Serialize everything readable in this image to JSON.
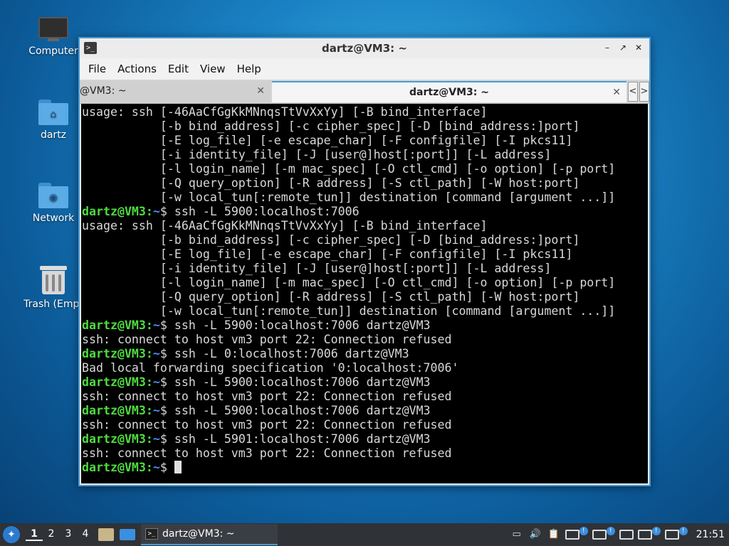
{
  "desktop": {
    "icons": [
      {
        "label": "Computer"
      },
      {
        "label": "dartz"
      },
      {
        "label": "Network"
      },
      {
        "label": "Trash (Empt"
      }
    ]
  },
  "window": {
    "title": "dartz@VM3: ~",
    "controls": {
      "minimize": "–",
      "maximize": "↗",
      "close": "✕"
    }
  },
  "menu": [
    "File",
    "Actions",
    "Edit",
    "View",
    "Help"
  ],
  "tabs": {
    "inactive_label": "@VM3: ~",
    "active_label": "dartz@VM3: ~",
    "close": "✕",
    "prev": "<",
    "next": ">"
  },
  "terminal": {
    "lines": [
      {
        "t": "usage: ssh [-46AaCfGgKkMNnqsTtVvXxYy] [-B bind_interface]"
      },
      {
        "t": "           [-b bind_address] [-c cipher_spec] [-D [bind_address:]port]"
      },
      {
        "t": "           [-E log_file] [-e escape_char] [-F configfile] [-I pkcs11]"
      },
      {
        "t": "           [-i identity_file] [-J [user@]host[:port]] [-L address]"
      },
      {
        "t": "           [-l login_name] [-m mac_spec] [-O ctl_cmd] [-o option] [-p port]"
      },
      {
        "t": "           [-Q query_option] [-R address] [-S ctl_path] [-W host:port]"
      },
      {
        "t": "           [-w local_tun[:remote_tun]] destination [command [argument ...]]"
      },
      {
        "p": "dartz@VM3",
        "path": "~",
        "cmd": "$ ssh -L 5900:localhost:7006"
      },
      {
        "t": "usage: ssh [-46AaCfGgKkMNnqsTtVvXxYy] [-B bind_interface]"
      },
      {
        "t": "           [-b bind_address] [-c cipher_spec] [-D [bind_address:]port]"
      },
      {
        "t": "           [-E log_file] [-e escape_char] [-F configfile] [-I pkcs11]"
      },
      {
        "t": "           [-i identity_file] [-J [user@]host[:port]] [-L address]"
      },
      {
        "t": "           [-l login_name] [-m mac_spec] [-O ctl_cmd] [-o option] [-p port]"
      },
      {
        "t": "           [-Q query_option] [-R address] [-S ctl_path] [-W host:port]"
      },
      {
        "t": "           [-w local_tun[:remote_tun]] destination [command [argument ...]]"
      },
      {
        "p": "dartz@VM3",
        "path": "~",
        "cmd": "$ ssh -L 5900:localhost:7006 dartz@VM3"
      },
      {
        "t": "ssh: connect to host vm3 port 22: Connection refused"
      },
      {
        "p": "dartz@VM3",
        "path": "~",
        "cmd": "$ ssh -L 0:localhost:7006 dartz@VM3"
      },
      {
        "t": "Bad local forwarding specification '0:localhost:7006'"
      },
      {
        "p": "dartz@VM3",
        "path": "~",
        "cmd": "$ ssh -L 5900:localhost:7006 dartz@VM3"
      },
      {
        "t": "ssh: connect to host vm3 port 22: Connection refused"
      },
      {
        "p": "dartz@VM3",
        "path": "~",
        "cmd": "$ ssh -L 5900:localhost:7006 dartz@VM3"
      },
      {
        "t": "ssh: connect to host vm3 port 22: Connection refused"
      },
      {
        "p": "dartz@VM3",
        "path": "~",
        "cmd": "$ ssh -L 5901:localhost:7006 dartz@VM3"
      },
      {
        "t": "ssh: connect to host vm3 port 22: Connection refused"
      },
      {
        "p": "dartz@VM3",
        "path": "~",
        "cmd": "$ ",
        "cursor": true
      }
    ]
  },
  "taskbar": {
    "workspaces": [
      "1",
      "2",
      "3",
      "4"
    ],
    "active_workspace": "1",
    "task_label": "dartz@VM3: ~",
    "clock": "21:51"
  }
}
